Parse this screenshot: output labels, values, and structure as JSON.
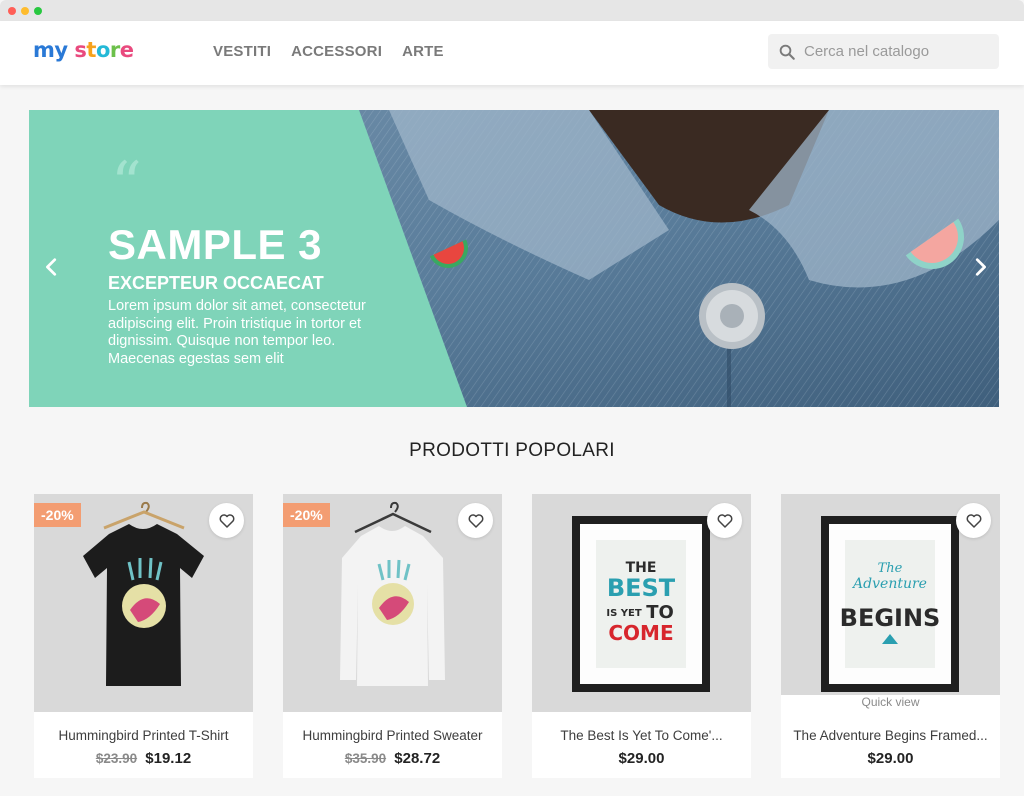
{
  "store": {
    "logo_text_1": "my",
    "logo_text_2": "store"
  },
  "nav": {
    "items": [
      "VESTITI",
      "ACCESSORI",
      "ARTE"
    ]
  },
  "search": {
    "placeholder": "Cerca nel catalogo"
  },
  "slider": {
    "title": "SAMPLE 3",
    "subtitle": "EXCEPTEUR OCCAECAT",
    "description": "Lorem ipsum dolor sit amet, consectetur adipiscing elit. Proin tristique in tortor et dignissim. Quisque non tempor leo. Maecenas egestas sem elit",
    "quote_mark": "“",
    "colors": {
      "panel": "#7fd4b9"
    }
  },
  "section": {
    "title": "PRODOTTI POPOLARI"
  },
  "products": [
    {
      "name": "Hummingbird Printed T-Shirt",
      "badge": "-20%",
      "old_price": "$23.90",
      "price": "$19.12"
    },
    {
      "name": "Hummingbird Printed Sweater",
      "badge": "-20%",
      "old_price": "$35.90",
      "price": "$28.72"
    },
    {
      "name": "The Best Is Yet To Come'...",
      "price": "$29.00",
      "poster_lines": [
        "THE",
        "BEST",
        "IS YET",
        "TO",
        "COME"
      ]
    },
    {
      "name": "The Adventure Begins Framed...",
      "price": "$29.00",
      "quick_view": "Quick view",
      "poster_lines": [
        "The",
        "Adventure",
        "BEGINS"
      ]
    }
  ],
  "colors": {
    "accent": "#24b9d7",
    "badge": "#f39d72",
    "teal": "#7fd4b9"
  }
}
